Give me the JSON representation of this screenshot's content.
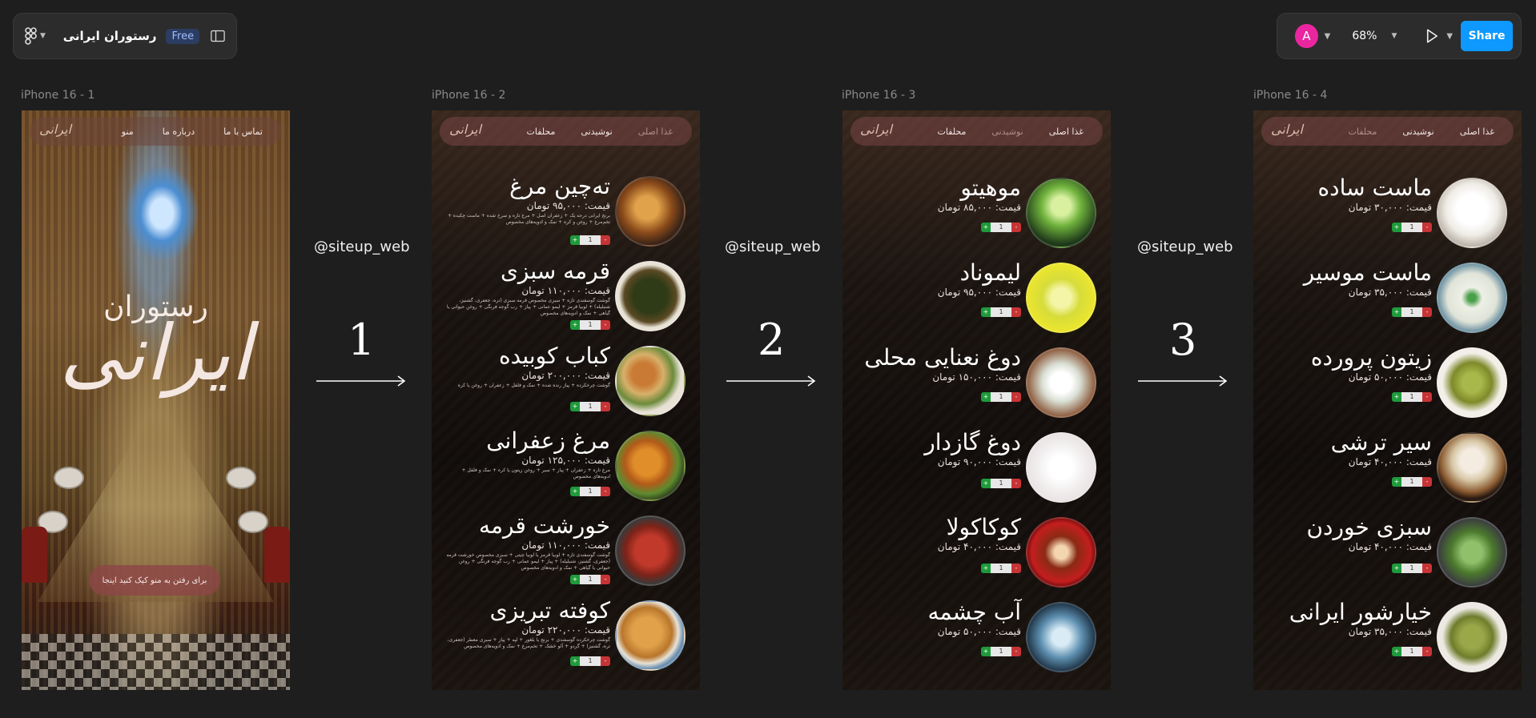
{
  "toolbar": {
    "file_title": "رستوران ایرانی",
    "plan_badge": "Free",
    "avatar_initial": "A",
    "zoom": "68%",
    "share_label": "Share"
  },
  "frames": [
    {
      "label": "iPhone 16 - 1",
      "nav": [
        "تماس با ما",
        "درباره ما",
        "منو"
      ],
      "logo": "ایرانی",
      "hero_small": "رستوران",
      "hero_big": "ایرانی",
      "cta": "برای رفتن به منو کیک کنید اینجا"
    },
    {
      "label": "iPhone 16 - 2",
      "nav": [
        "غذا اصلی",
        "نوشیدنی",
        "محلفات"
      ],
      "logo": "ایرانی",
      "items": [
        {
          "name": "ته‌چین مرغ",
          "price": "قیمت: ۹۵,۰۰۰ تومان",
          "desc": "برنج ایرانی درجه یک + زعفران اصل + مرغ تازه و سرخ شده + ماست چکیده + تخم‌مرغ + روغن و کره + نمک و ادویه‌های مخصوص",
          "qty": "1",
          "color": "#b5702b"
        },
        {
          "name": "قرمه سبزی",
          "price": "قیمت: ۱۱۰,۰۰۰ تومان",
          "desc": "گوشت گوسفندی تازه + سبزی مخصوص قرمه سبزی (تره، جعفری، گشنیز، شنبلیله) + لوبیا قرمز + لیمو عمانی + پیاز + رب گوجه فرنگی + روغن حیوانی یا گیاهی + نمک و ادویه‌های مخصوص",
          "qty": "1",
          "color": "#3c4a1e"
        },
        {
          "name": "کباب کوبیده",
          "price": "قیمت: ۲۰۰,۰۰۰ تومان",
          "desc": "گوشت چرخکرده + پیاز رنده شده + نمک و فلفل + زعفران + روغن یا کره",
          "qty": "1",
          "color": "#a86a2a"
        },
        {
          "name": "مرغ زعفرانی",
          "price": "قیمت: ۱۲۵,۰۰۰ تومان",
          "desc": "مرغ تازه + زعفران + پیاز + سیر + روغن زیتون یا کره + نمک و فلفل + ادویه‌های مخصوص",
          "qty": "1",
          "color": "#c27a20"
        },
        {
          "name": "خورشت قرمه",
          "price": "قیمت: ۱۱۰,۰۰۰ تومان",
          "desc": "گوشت گوسفندی تازه + لوبیا قرمز یا لوبیا چیتی + سبزی مخصوص خورشت قرمه (جعفری، گشنیز، شنبلیله) + پیاز + لیمو عمانی + رب گوجه فرنگی + روغن حیوانی یا گیاهی + نمک و ادویه‌های مخصوص",
          "qty": "1",
          "color": "#b23a1f"
        },
        {
          "name": "کوفته تبریزی",
          "price": "قیمت: ۲۲۰,۰۰۰ تومان",
          "desc": "گوشت چرخکرده گوسفندی + برنج یا بلغور + لپه + پیاز + سبزی معطر (جعفری، تره، گشنیز) + گردو + آلو خشک + تخم‌مرغ + نمک و ادویه‌های مخصوص",
          "qty": "1",
          "color": "#c98a3a"
        }
      ]
    },
    {
      "label": "iPhone 16 - 3",
      "nav": [
        "غذا اصلی",
        "نوشیدنی",
        "محلفات"
      ],
      "logo": "ایرانی",
      "items": [
        {
          "name": "موهیتو",
          "price": "قیمت: ۸۵,۰۰۰ تومان",
          "qty": "1",
          "color": "#5ea63a"
        },
        {
          "name": "لیموناد",
          "price": "قیمت: ۹۵,۰۰۰ تومان",
          "qty": "1",
          "color": "#e8e23a"
        },
        {
          "name": "دوغ نعنایی محلی",
          "price": "قیمت: ۱۵۰,۰۰۰ تومان",
          "qty": "1",
          "color": "#e7ebe4"
        },
        {
          "name": "دوغ گازدار",
          "price": "قیمت: ۹۰,۰۰۰ تومان",
          "qty": "1",
          "color": "#f1efef"
        },
        {
          "name": "کوکاکولا",
          "price": "قیمت: ۴۰,۰۰۰ تومان",
          "qty": "1",
          "color": "#c41e1e"
        },
        {
          "name": "آب چشمه",
          "price": "قیمت: ۵۰,۰۰۰ تومان",
          "qty": "1",
          "color": "#5d8fb0"
        }
      ]
    },
    {
      "label": "iPhone 16 - 4",
      "nav": [
        "غذا اصلی",
        "نوشیدنی",
        "محلفات"
      ],
      "logo": "ایرانی",
      "items": [
        {
          "name": "ماست ساده",
          "price": "قیمت: ۳۰,۰۰۰ تومان",
          "qty": "1",
          "color": "#f3f1ea"
        },
        {
          "name": "ماست موسیر",
          "price": "قیمت: ۳۵,۰۰۰ تومان",
          "qty": "1",
          "color": "#eef0e6"
        },
        {
          "name": "زیتون پرورده",
          "price": "قیمت: ۵۰,۰۰۰ تومان",
          "qty": "1",
          "color": "#7d8a2a"
        },
        {
          "name": "سیر ترشی",
          "price": "قیمت: ۴۰,۰۰۰ تومان",
          "qty": "1",
          "color": "#d7c7a6"
        },
        {
          "name": "سبزی خوردن",
          "price": "قیمت: ۴۰,۰۰۰ تومان",
          "qty": "1",
          "color": "#4c7a2d"
        },
        {
          "name": "خیارشور ایرانی",
          "price": "قیمت: ۳۵,۰۰۰ تومان",
          "qty": "1",
          "color": "#6f7d2c"
        }
      ]
    }
  ],
  "connectors": [
    {
      "handle": "@siteup_web",
      "step": "1"
    },
    {
      "handle": "@siteup_web",
      "step": "2"
    },
    {
      "handle": "@siteup_web",
      "step": "3"
    }
  ],
  "qty_controls": {
    "plus": "+",
    "minus": "-"
  }
}
